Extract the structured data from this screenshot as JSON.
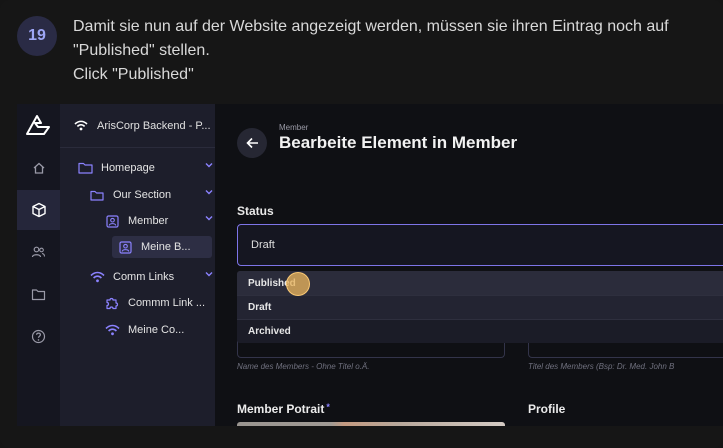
{
  "step": {
    "number": "19",
    "lines": [
      "Damit sie nun auf der Website angezeigt werden, müssen sie ihren Eintrag noch auf",
      "\"Published\" stellen.",
      "Click \"Published\""
    ]
  },
  "sidebar": {
    "rail_icons": [
      "home-icon",
      "box-icon",
      "users-icon",
      "folder-icon",
      "help-icon"
    ],
    "project_name": "ArisCorp Backend - P...",
    "tree": [
      {
        "label": "Homepage",
        "icon": "folder-icon"
      },
      {
        "label": "Our Section",
        "icon": "folder-icon"
      },
      {
        "label": "Member",
        "icon": "contact-icon"
      },
      {
        "label": "Meine B...",
        "icon": "contact-icon"
      },
      {
        "label": "Comm Links",
        "icon": "wifi-icon"
      },
      {
        "label": "Commm Link ...",
        "icon": "puzzle-icon"
      },
      {
        "label": "Meine Co...",
        "icon": "wifi-icon"
      }
    ]
  },
  "main": {
    "breadcrumb": "Member",
    "title": "Bearbeite Element in Member",
    "status": {
      "label": "Status",
      "value": "Draft",
      "options": [
        "Published",
        "Draft",
        "Archived"
      ]
    },
    "hints": {
      "name": "Name des Members - Ohne Titel o.Ä.",
      "title": "Titel des Members (Bsp: Dr. Med. John B"
    },
    "portrait_label": "Member Potrait",
    "required_mark": "*",
    "profile_label": "Profile"
  },
  "colors": {
    "accent": "#7d74e8",
    "badge_text": "#9ea6f5",
    "click_marker": "#e8b45c"
  }
}
